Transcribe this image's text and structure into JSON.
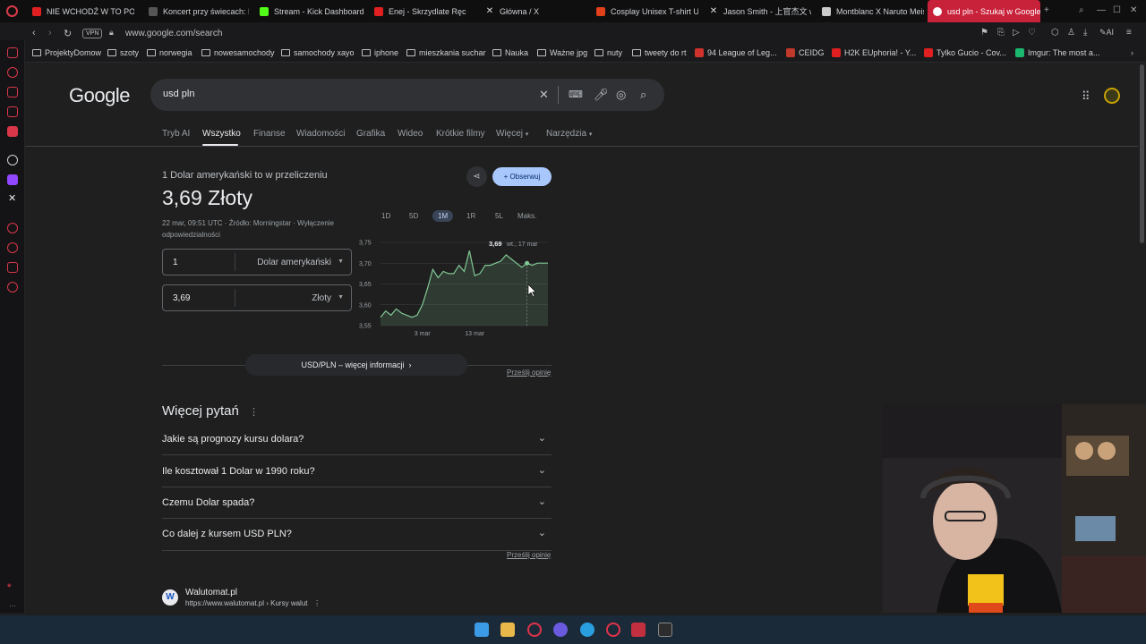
{
  "browser": {
    "tabs": [
      {
        "title": "NIE WCHODŹ W TO PO 3:",
        "color": "#e02020"
      },
      {
        "title": "Koncert przy świecach: M",
        "color": "#888888"
      },
      {
        "title": "Stream - Kick Dashboard",
        "color": "#53fc18"
      },
      {
        "title": "Enej - Skrzydlate Ręc",
        "color": "#e02020"
      },
      {
        "title": "Główna / X",
        "color": "#dddddd"
      },
      {
        "title": "Cosplay Unisex T-shirt U",
        "color": "#e0401a"
      },
      {
        "title": "Jason Smith - 上官杰文 w",
        "color": "#dddddd"
      },
      {
        "title": "Montblanc X Naruto Meis",
        "color": "#dddddd"
      },
      {
        "title": "usd pln - Szukaj w Google",
        "color": "#ffffff"
      }
    ],
    "new_tab": "+",
    "vpn_label": "VPN",
    "url": "www.google.com/search",
    "ai_label": "AI",
    "bookmarks": [
      {
        "label": "ProjektyDomow",
        "type": "folder"
      },
      {
        "label": "szoty",
        "type": "folder"
      },
      {
        "label": "norwegia",
        "type": "folder"
      },
      {
        "label": "nowesamochody",
        "type": "folder"
      },
      {
        "label": "samochody xayo",
        "type": "folder"
      },
      {
        "label": "iphone",
        "type": "folder"
      },
      {
        "label": "mieszkania suchar",
        "type": "folder"
      },
      {
        "label": "Nauka",
        "type": "folder"
      },
      {
        "label": "Ważne jpg",
        "type": "folder"
      },
      {
        "label": "nuty",
        "type": "folder"
      },
      {
        "label": "tweety do rt",
        "type": "folder"
      },
      {
        "label": "94 League of Leg...",
        "type": "site",
        "color": "#d0322d"
      },
      {
        "label": "CEIDG",
        "type": "site",
        "color": "#c0392b"
      },
      {
        "label": "H2K EUphoria! - Y...",
        "type": "site",
        "color": "#e02020"
      },
      {
        "label": "Tylko Gucio - Cov...",
        "type": "site",
        "color": "#e02020"
      },
      {
        "label": "Imgur: The most a...",
        "type": "site",
        "color": "#1bb76e"
      }
    ]
  },
  "google": {
    "logo": "Google",
    "query": "usd pln",
    "tabs": [
      "Tryb AI",
      "Wszystko",
      "Finanse",
      "Wiadomości",
      "Grafika",
      "Wideo",
      "Krótkie filmy",
      "Więcej",
      "Narzędzia"
    ],
    "active_tab": "Wszystko"
  },
  "converter": {
    "headline": "1 Dolar amerykański to w przeliczeniu",
    "value": "3,69 Złoty",
    "meta": "22 mar, 09:51 UTC · Źródło: Morningstar · Wyłączenie odpowiedzialności",
    "follow_label": "Obserwuj",
    "from_amount": "1",
    "from_currency": "Dolar amerykański",
    "to_amount": "3,69",
    "to_currency": "Złoty",
    "ranges": [
      "1D",
      "5D",
      "1M",
      "1R",
      "5L",
      "Maks."
    ],
    "active_range": "1M",
    "more_info": "USD/PLN – więcej informacji",
    "feedback": "Prześlij opinię"
  },
  "chart_data": {
    "type": "area",
    "ylim": [
      3.55,
      3.75
    ],
    "yticks": [
      "3,75",
      "3,70",
      "3,65",
      "3,60",
      "3,55"
    ],
    "xticks": [
      "3 mar",
      "13 mar"
    ],
    "values": [
      3.57,
      3.585,
      3.575,
      3.59,
      3.58,
      3.575,
      3.57,
      3.575,
      3.6,
      3.64,
      3.685,
      3.665,
      3.68,
      3.675,
      3.675,
      3.695,
      3.68,
      3.73,
      3.67,
      3.675,
      3.695,
      3.695,
      3.7,
      3.705,
      3.72,
      3.71,
      3.7,
      3.69,
      3.7,
      3.695,
      3.7,
      3.7,
      3.7
    ],
    "tooltip": {
      "value": "3,69",
      "label": "wt., 17 mar"
    },
    "color": "#81c995"
  },
  "paa": {
    "title": "Więcej pytań",
    "questions": [
      "Jakie są prognozy kursu dolara?",
      "Ile kosztował 1 Dolar w 1990 roku?",
      "Czemu Dolar spada?",
      "Co dalej z kursem USD PLN?"
    ],
    "feedback": "Prześlij opinię"
  },
  "result": {
    "icon_letter": "W",
    "name": "Walutomat.pl",
    "url": "https://www.walutomat.pl › Kursy walut"
  }
}
